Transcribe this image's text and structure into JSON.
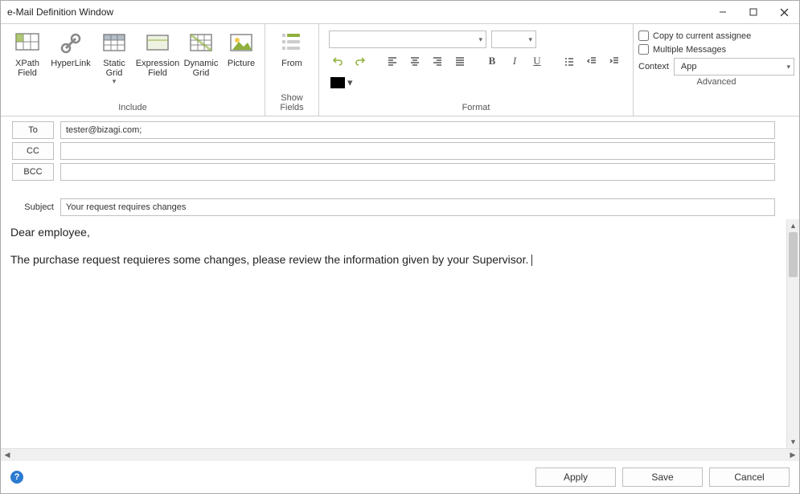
{
  "window": {
    "title": "e-Mail Definition Window"
  },
  "ribbon": {
    "include": {
      "label": "Include",
      "xpath": "XPath Field",
      "hyperlink": "HyperLink",
      "staticgrid": "Static Grid",
      "exprfield": "Expression Field",
      "dyngrid": "Dynamic Grid",
      "picture": "Picture"
    },
    "showfields": {
      "label": "Show Fields",
      "from": "From"
    },
    "format": {
      "label": "Format"
    },
    "advanced": {
      "label": "Advanced",
      "copy": "Copy to current assignee",
      "multiple": "Multiple Messages",
      "contextLabel": "Context",
      "contextValue": "App"
    }
  },
  "fields": {
    "to": {
      "label": "To",
      "value": "tester@bizagi.com;"
    },
    "cc": {
      "label": "CC",
      "value": ""
    },
    "bcc": {
      "label": "BCC",
      "value": ""
    },
    "subject": {
      "label": "Subject",
      "value": "Your request requires changes"
    }
  },
  "body": {
    "line1": "Dear employee,",
    "line2": "The purchase request requieres some changes, please review the information given by your Supervisor."
  },
  "footer": {
    "apply": "Apply",
    "save": "Save",
    "cancel": "Cancel"
  }
}
